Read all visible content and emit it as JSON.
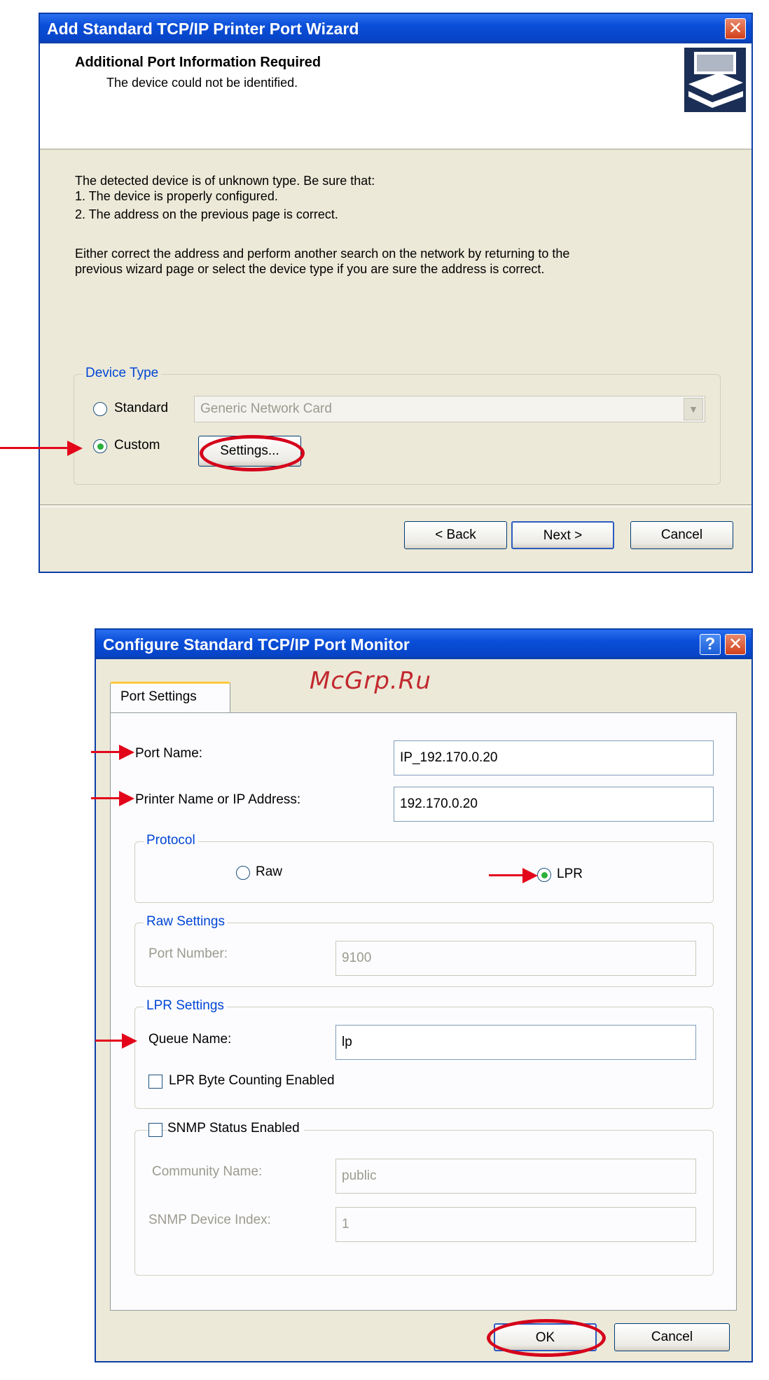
{
  "wizard": {
    "title": "Add Standard TCP/IP Printer Port Wizard",
    "close_glyph": "✕",
    "header_title": "Additional Port Information Required",
    "header_subtitle": "The device could not be identified.",
    "body_lines": [
      "The detected device is of unknown type.  Be sure that:",
      "1. The device is properly configured.",
      "2.  The address on the previous page is correct."
    ],
    "body_para_2": [
      "Either correct the address and perform another search on the network by returning to the",
      "previous wizard page or select the device type if you are sure the address is correct."
    ],
    "device_type": {
      "group_label": "Device Type",
      "standard_label": "Standard",
      "standard_value": "Generic Network Card",
      "custom_label": "Custom",
      "selected": "Custom",
      "settings_button": "Settings..."
    },
    "buttons": {
      "back": "< Back",
      "next": "Next >",
      "cancel": "Cancel"
    }
  },
  "monitor": {
    "title": "Configure Standard TCP/IP Port Monitor",
    "help_glyph": "?",
    "close_glyph": "✕",
    "tab": "Port Settings",
    "port_name_label": "Port Name:",
    "port_name_value": "IP_192.170.0.20",
    "printer_name_label": "Printer Name or IP Address:",
    "printer_name_value": "192.170.0.20",
    "protocol": {
      "group_label": "Protocol",
      "raw_label": "Raw",
      "lpr_label": "LPR",
      "selected": "LPR"
    },
    "raw_settings": {
      "group_label": "Raw Settings",
      "port_number_label": "Port Number:",
      "port_number_value": "9100"
    },
    "lpr_settings": {
      "group_label": "LPR Settings",
      "queue_name_label": "Queue Name:",
      "queue_name_value": "lp",
      "byte_counting_label": "LPR Byte Counting Enabled",
      "byte_counting_checked": false
    },
    "snmp": {
      "enabled_label": "SNMP Status Enabled",
      "enabled_checked": false,
      "community_label": "Community Name:",
      "community_value": "public",
      "device_index_label": "SNMP Device Index:",
      "device_index_value": "1"
    },
    "buttons": {
      "ok": "OK",
      "cancel": "Cancel"
    }
  },
  "watermark": "McGrp.Ru",
  "colors": {
    "annotation_red": "#e3061b",
    "titlebar_blue": "#0a4ed8",
    "dialog_bg": "#ece9d8"
  }
}
